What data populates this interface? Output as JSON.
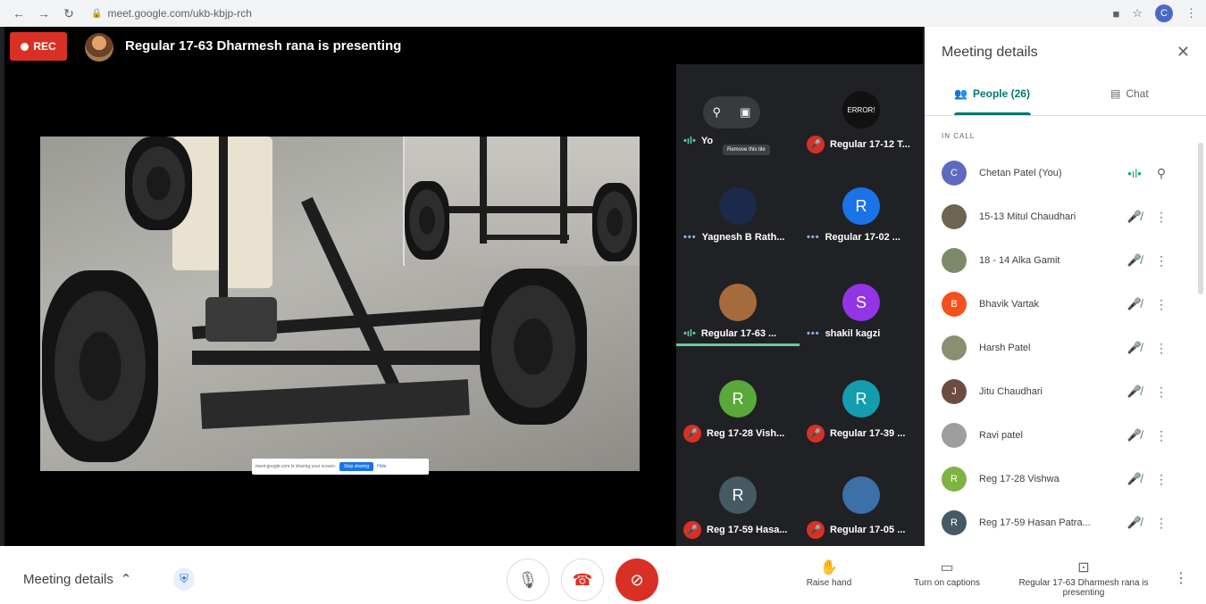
{
  "browser": {
    "url": "meet.google.com/ukb-kbjp-rch",
    "profile_initial": "C"
  },
  "stage": {
    "rec_label": "REC",
    "presenting_title": "Regular 17-63 Dharmesh rana is presenting",
    "share_banner": {
      "text": "meet.google.com is sharing your screen.",
      "stop_label": "Stop sharing",
      "hide_label": "Hide"
    }
  },
  "tiles": [
    {
      "name": "Yo",
      "initial": "",
      "avatar_color": "",
      "status": "speaking",
      "popup": true,
      "tooltip": "Remove this tile"
    },
    {
      "name": "Regular 17-12 T...",
      "initial": "",
      "avatar_color": "#111111",
      "avatar_text": "ERROR!",
      "status": "muted"
    },
    {
      "name": "Yagnesh B Rath...",
      "initial": "",
      "avatar_color": "#1b2a4a",
      "status": "dots"
    },
    {
      "name": "Regular 17-02 ...",
      "initial": "R",
      "avatar_color": "#1a73e8",
      "status": "dots"
    },
    {
      "name": "Regular 17-63 ...",
      "initial": "",
      "avatar_color": "#a66b3d",
      "status": "speaking",
      "active": true
    },
    {
      "name": "shakil kagzi",
      "initial": "S",
      "avatar_color": "#9334e6",
      "status": "dots"
    },
    {
      "name": "Reg 17-28 Vish...",
      "initial": "R",
      "avatar_color": "#5aa83a",
      "status": "muted"
    },
    {
      "name": "Regular 17-39 ...",
      "initial": "R",
      "avatar_color": "#129eaf",
      "status": "muted"
    },
    {
      "name": "Reg 17-59 Hasa...",
      "initial": "R",
      "avatar_color": "#455a64",
      "status": "muted"
    },
    {
      "name": "Regular 17-05 ...",
      "initial": "",
      "avatar_color": "#3d6fa8",
      "status": "muted"
    }
  ],
  "panel": {
    "title": "Meeting details",
    "tab_people": "People (26)",
    "tab_chat": "Chat",
    "section_label": "IN CALL",
    "people": [
      {
        "name": "Chetan Patel (You)",
        "initial": "C",
        "color": "#5c6bc0",
        "status": "speaking",
        "pin": true
      },
      {
        "name": "15-13 Mitul Chaudhari",
        "initial": "",
        "color": "#6d6552",
        "status": "muted"
      },
      {
        "name": "18 - 14 Alka Gamit",
        "initial": "",
        "color": "#7d8a6a",
        "status": "muted"
      },
      {
        "name": "Bhavik Vartak",
        "initial": "B",
        "color": "#f4511e",
        "status": "muted"
      },
      {
        "name": "Harsh Patel",
        "initial": "",
        "color": "#8a8f6f",
        "status": "muted"
      },
      {
        "name": "Jitu Chaudhari",
        "initial": "J",
        "color": "#6d4c41",
        "status": "muted"
      },
      {
        "name": "Ravi patel",
        "initial": "",
        "color": "#9e9e9e",
        "status": "muted"
      },
      {
        "name": "Reg 17-28 Vishwa",
        "initial": "R",
        "color": "#7cb342",
        "status": "muted"
      },
      {
        "name": "Reg 17-59 Hasan Patra...",
        "initial": "R",
        "color": "#455a64",
        "status": "muted"
      }
    ]
  },
  "bottom": {
    "meeting_details": "Meeting details",
    "raise_hand": "Raise hand",
    "captions": "Turn on captions",
    "presenting": "Regular 17-63 Dharmesh rana is presenting"
  },
  "colors": {
    "accent": "#00796b",
    "danger": "#d93025",
    "speaking": "#5ecf9e"
  }
}
